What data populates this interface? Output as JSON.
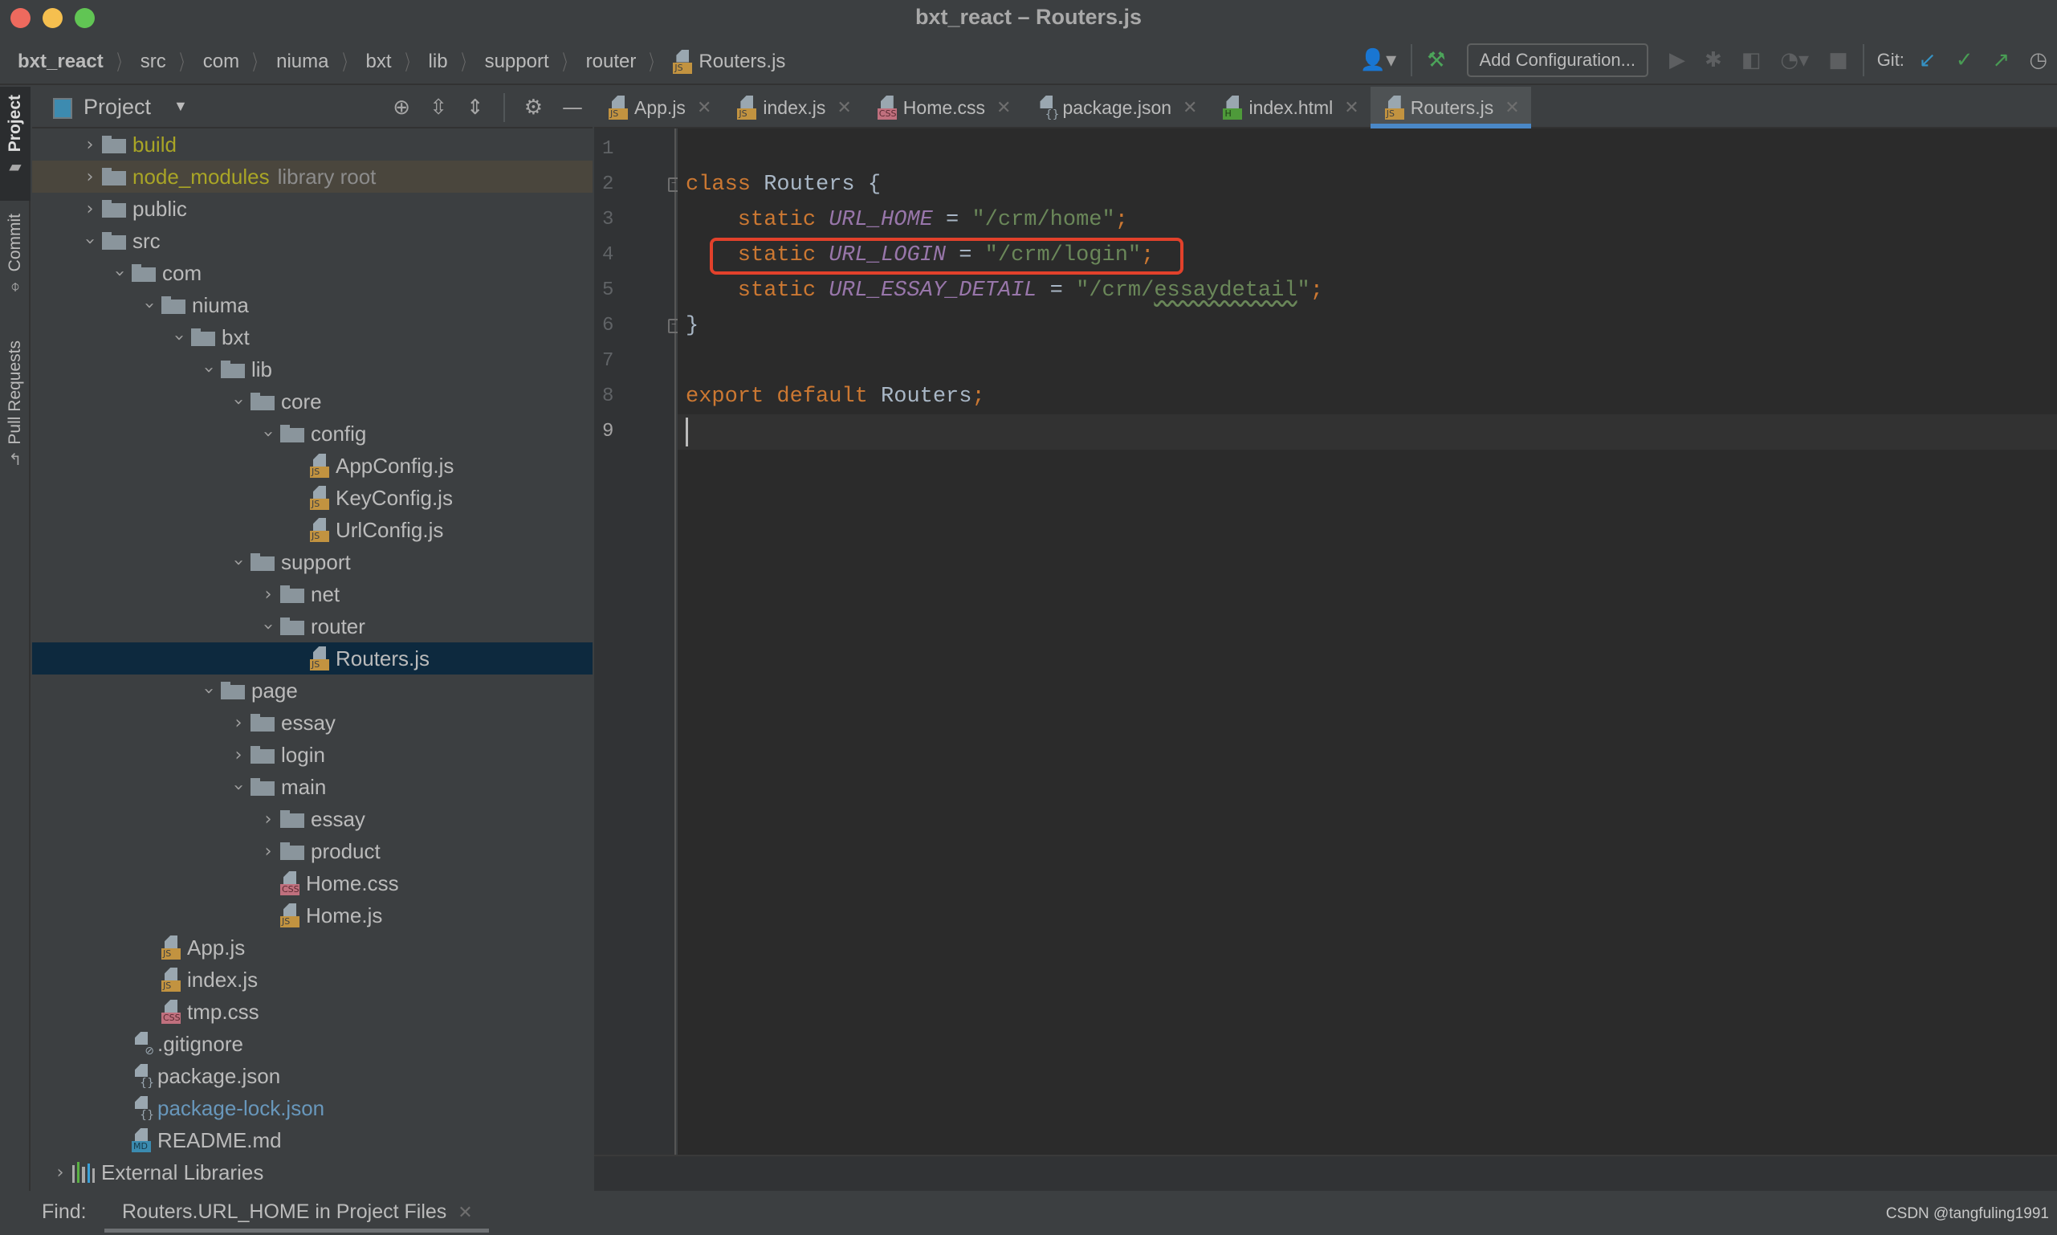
{
  "window": {
    "title": "bxt_react – Routers.js"
  },
  "breadcrumb": [
    "bxt_react",
    "src",
    "com",
    "niuma",
    "bxt",
    "lib",
    "support",
    "router",
    "Routers.js"
  ],
  "toolbar": {
    "add_configuration_label": "Add Configuration...",
    "git_label": "Git:",
    "icons": [
      "user-icon",
      "build-hammer-icon",
      "run-icon",
      "debug-icon",
      "coverage-icon",
      "profile-icon",
      "stop-icon",
      "git-update-icon",
      "git-commit-icon",
      "git-push-icon",
      "history-icon"
    ]
  },
  "tool_strip": {
    "items": [
      {
        "label": "Project",
        "active": true
      },
      {
        "label": "Commit",
        "active": false
      },
      {
        "label": "Pull Requests",
        "active": false
      }
    ]
  },
  "project_panel": {
    "title": "Project",
    "tree": [
      {
        "label": "build",
        "type": "folder",
        "depth": 0,
        "expanded": false,
        "style": "excluded"
      },
      {
        "label": "node_modules",
        "hint": "library root",
        "type": "folder",
        "depth": 0,
        "expanded": false,
        "style": "excluded",
        "row": "lib"
      },
      {
        "label": "public",
        "type": "folder",
        "depth": 0,
        "expanded": false
      },
      {
        "label": "src",
        "type": "folder",
        "depth": 0,
        "expanded": true
      },
      {
        "label": "com",
        "type": "folder",
        "depth": 1,
        "expanded": true
      },
      {
        "label": "niuma",
        "type": "folder",
        "depth": 2,
        "expanded": true
      },
      {
        "label": "bxt",
        "type": "folder",
        "depth": 3,
        "expanded": true
      },
      {
        "label": "lib",
        "type": "folder",
        "depth": 4,
        "expanded": true
      },
      {
        "label": "core",
        "type": "folder",
        "depth": 5,
        "expanded": true
      },
      {
        "label": "config",
        "type": "folder",
        "depth": 6,
        "expanded": true
      },
      {
        "label": "AppConfig.js",
        "type": "js",
        "depth": 7
      },
      {
        "label": "KeyConfig.js",
        "type": "js",
        "depth": 7
      },
      {
        "label": "UrlConfig.js",
        "type": "js",
        "depth": 7
      },
      {
        "label": "support",
        "type": "folder",
        "depth": 5,
        "expanded": true
      },
      {
        "label": "net",
        "type": "folder",
        "depth": 6,
        "expanded": false
      },
      {
        "label": "router",
        "type": "folder",
        "depth": 6,
        "expanded": true
      },
      {
        "label": "Routers.js",
        "type": "js",
        "depth": 7,
        "row": "selected"
      },
      {
        "label": "page",
        "type": "folder",
        "depth": 4,
        "expanded": true
      },
      {
        "label": "essay",
        "type": "folder",
        "depth": 5,
        "expanded": false
      },
      {
        "label": "login",
        "type": "folder",
        "depth": 5,
        "expanded": false
      },
      {
        "label": "main",
        "type": "folder",
        "depth": 5,
        "expanded": true
      },
      {
        "label": "essay",
        "type": "folder",
        "depth": 6,
        "expanded": false
      },
      {
        "label": "product",
        "type": "folder",
        "depth": 6,
        "expanded": false
      },
      {
        "label": "Home.css",
        "type": "css",
        "depth": 6
      },
      {
        "label": "Home.js",
        "type": "js",
        "depth": 6
      },
      {
        "label": "App.js",
        "type": "js",
        "depth": 2
      },
      {
        "label": "index.js",
        "type": "js",
        "depth": 2
      },
      {
        "label": "tmp.css",
        "type": "css",
        "depth": 2
      },
      {
        "label": ".gitignore",
        "type": "gitignore",
        "depth": 1
      },
      {
        "label": "package.json",
        "type": "json",
        "depth": 1
      },
      {
        "label": "package-lock.json",
        "type": "json",
        "depth": 1,
        "style": "added"
      },
      {
        "label": "README.md",
        "type": "md",
        "depth": 1
      },
      {
        "label": "External Libraries",
        "type": "extlib",
        "depth": -1,
        "expanded": false
      }
    ]
  },
  "tabs": [
    {
      "label": "App.js",
      "type": "js",
      "active": false
    },
    {
      "label": "index.js",
      "type": "js",
      "active": false
    },
    {
      "label": "Home.css",
      "type": "css",
      "active": false
    },
    {
      "label": "package.json",
      "type": "json",
      "active": false
    },
    {
      "label": "index.html",
      "type": "html",
      "active": false
    },
    {
      "label": "Routers.js",
      "type": "js",
      "active": true
    }
  ],
  "editor": {
    "current_line": 9,
    "highlighted_line": 4,
    "lines": [
      {
        "n": "1",
        "tokens": []
      },
      {
        "n": "2",
        "tokens": [
          {
            "t": "class ",
            "c": "kw"
          },
          {
            "t": "Routers ",
            "c": "cls"
          },
          {
            "t": "{",
            "c": "cls"
          }
        ],
        "fold": "open"
      },
      {
        "n": "3",
        "tokens": [
          {
            "t": "    static ",
            "c": "kw"
          },
          {
            "t": "URL_HOME",
            "c": "field"
          },
          {
            "t": " = ",
            "c": "cls"
          },
          {
            "t": "\"/crm/home\"",
            "c": "str"
          },
          {
            "t": ";",
            "c": "kw"
          }
        ]
      },
      {
        "n": "4",
        "tokens": [
          {
            "t": "    static ",
            "c": "kw"
          },
          {
            "t": "URL_LOGIN",
            "c": "field"
          },
          {
            "t": " = ",
            "c": "cls"
          },
          {
            "t": "\"/crm/login\"",
            "c": "str"
          },
          {
            "t": ";",
            "c": "kw"
          }
        ]
      },
      {
        "n": "5",
        "tokens": [
          {
            "t": "    static ",
            "c": "kw"
          },
          {
            "t": "URL_ESSAY_DETAIL",
            "c": "field"
          },
          {
            "t": " = ",
            "c": "cls"
          },
          {
            "t": "\"/crm/",
            "c": "str"
          },
          {
            "t": "essaydetail",
            "c": "str typo"
          },
          {
            "t": "\"",
            "c": "str"
          },
          {
            "t": ";",
            "c": "kw"
          }
        ]
      },
      {
        "n": "6",
        "tokens": [
          {
            "t": "}",
            "c": "cls"
          }
        ],
        "fold": "close"
      },
      {
        "n": "7",
        "tokens": []
      },
      {
        "n": "8",
        "tokens": [
          {
            "t": "export ",
            "c": "kw"
          },
          {
            "t": "default ",
            "c": "kw"
          },
          {
            "t": "Routers",
            "c": "cls"
          },
          {
            "t": ";",
            "c": "kw"
          }
        ]
      },
      {
        "n": "9",
        "tokens": []
      }
    ]
  },
  "find_bar": {
    "label": "Find:",
    "tab_label": "Routers.URL_HOME in Project Files"
  },
  "watermark": "CSDN @tangfuling1991"
}
